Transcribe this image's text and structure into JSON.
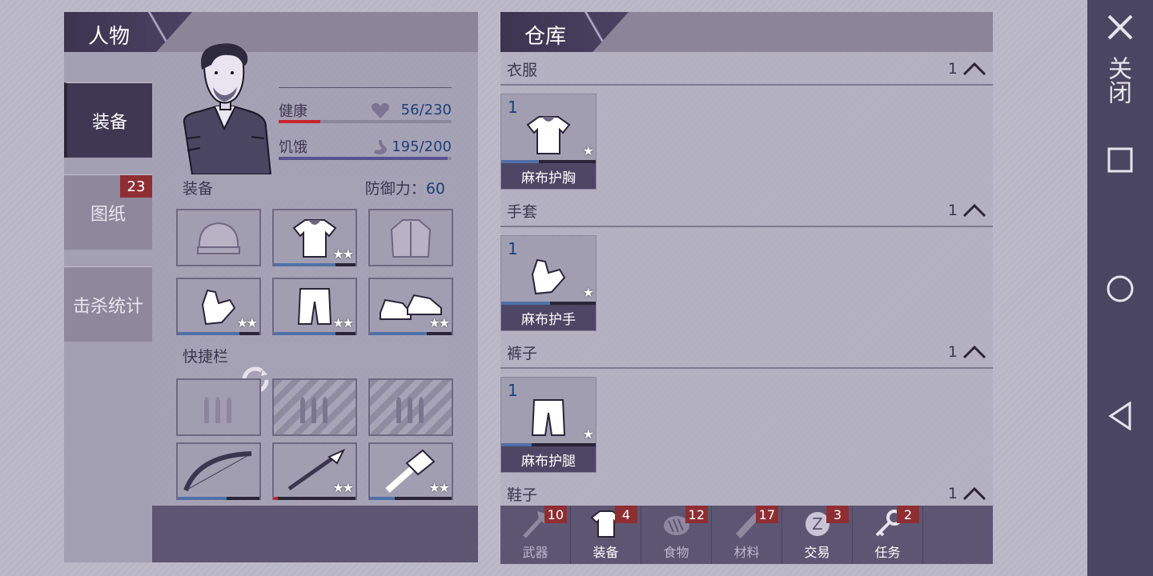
{
  "character": {
    "title": "人物",
    "side_tabs": [
      {
        "label": "装备",
        "badge": ""
      },
      {
        "label": "图纸",
        "badge": "23"
      },
      {
        "label": "击杀统计",
        "badge": ""
      }
    ],
    "health": {
      "label": "健康",
      "value": "56/230",
      "fraction": 0.243,
      "color": "#c8242e"
    },
    "hunger": {
      "label": "饥饿",
      "value": "195/200",
      "fraction": 0.975,
      "color": "#5a5290"
    },
    "equipment_header": "装备",
    "defense_label": "防御力：",
    "defense_value": "60",
    "quickbar_header": "快捷栏",
    "equip_slots": [
      {
        "icon": "beanie-icon",
        "stars": "",
        "durability": 0
      },
      {
        "icon": "linen-shirt-icon",
        "stars": "★★",
        "durability": 0.75
      },
      {
        "icon": "jacket-icon",
        "stars": "",
        "durability": 0
      },
      {
        "icon": "gloves-icon",
        "stars": "★★",
        "durability": 0.75
      },
      {
        "icon": "pants-icon",
        "stars": "★★",
        "durability": 0.75
      },
      {
        "icon": "shoes-icon",
        "stars": "★★",
        "durability": 0.7
      }
    ],
    "quick_slots": [
      {
        "icon": "ammo-icon",
        "stars": "",
        "locked": false,
        "durability": 0
      },
      {
        "icon": "ammo-icon",
        "stars": "",
        "locked": true,
        "durability": 0
      },
      {
        "icon": "ammo-icon",
        "stars": "",
        "locked": true,
        "durability": 0
      },
      {
        "icon": "bow-icon",
        "stars": "",
        "durability": 0.6
      },
      {
        "icon": "spear-icon",
        "stars": "★★",
        "durability": 0.05
      },
      {
        "icon": "hammer-icon",
        "stars": "★★",
        "durability": 0.3
      }
    ]
  },
  "storage": {
    "title": "仓库",
    "categories": [
      {
        "name": "衣服",
        "count": "1",
        "item": {
          "qty": "1",
          "name": "麻布护胸",
          "icon": "linen-shirt-icon",
          "stars": "★"
        }
      },
      {
        "name": "手套",
        "count": "1",
        "item": {
          "qty": "1",
          "name": "麻布护手",
          "icon": "gloves-icon",
          "stars": "★"
        }
      },
      {
        "name": "裤子",
        "count": "1",
        "item": {
          "qty": "1",
          "name": "麻布护腿",
          "icon": "pants-icon",
          "stars": "★"
        }
      },
      {
        "name": "鞋子",
        "count": "1"
      }
    ],
    "bottom_tabs": [
      {
        "label": "武器",
        "badge": "10",
        "icon": "axe-icon"
      },
      {
        "label": "装备",
        "badge": "4",
        "icon": "shirt-icon"
      },
      {
        "label": "食物",
        "badge": "12",
        "icon": "food-icon"
      },
      {
        "label": "材料",
        "badge": "17",
        "icon": "wood-icon"
      },
      {
        "label": "交易",
        "badge": "3",
        "icon": "coin-icon"
      },
      {
        "label": "任务",
        "badge": "2",
        "icon": "key-icon"
      }
    ]
  },
  "nav": {
    "close_label": "关闭"
  }
}
